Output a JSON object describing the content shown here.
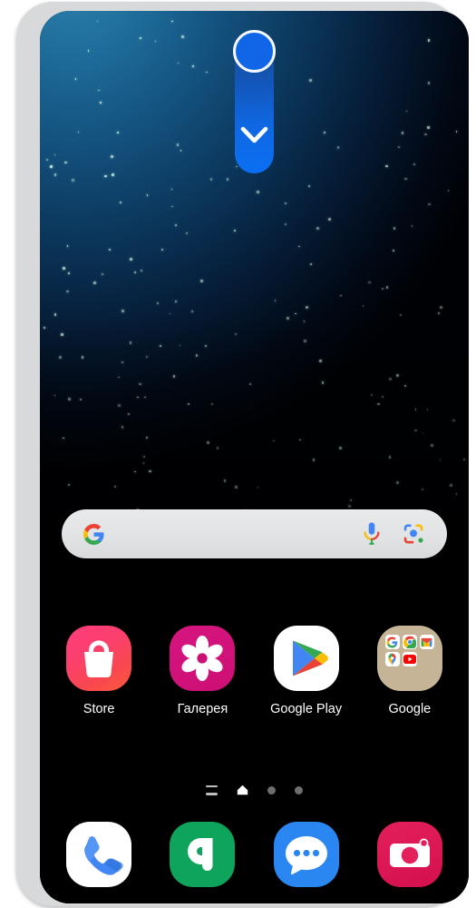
{
  "device": {
    "frame_color": "#d8d9da",
    "screen_background": "#000000"
  },
  "wallpaper": {
    "name": "starry-night-sky",
    "top_glow_color": "#2e82ad",
    "mid_color": "#0c3a60",
    "bottom_color": "#000000",
    "star_color": "#cfeede"
  },
  "widget": {
    "name": "edge-pull-handle",
    "circle_color": "#1066e6",
    "ring_color": "#f5f8ff",
    "pill_top_color": "#1b4e96",
    "pill_bottom_color": "#0b6ff2",
    "chevron_icon": "chevron-down-icon",
    "chevron_color": "#ffffff"
  },
  "search": {
    "placeholder": "",
    "value": "",
    "background": "#e4e5e6",
    "google_logo": "google-g-icon",
    "mic_icon": "microphone-icon",
    "lens_icon": "google-lens-icon"
  },
  "apps": [
    {
      "label": "Store",
      "icon": "galaxy-store-icon",
      "glyph": "shopping-bag",
      "bg_start": "#ff3d7c",
      "bg_end": "#fb5a3c",
      "fg": "#ffffff"
    },
    {
      "label": "Галерея",
      "icon": "gallery-icon",
      "glyph": "flower",
      "bg_start": "#d6157f",
      "bg_end": "#cd0f75",
      "fg": "#ffffff"
    },
    {
      "label": "Google Play",
      "icon": "google-play-icon",
      "glyph": "play-triangle",
      "bg_start": "#ffffff",
      "bg_end": "#ffffff",
      "fg": "#34a853"
    },
    {
      "label": "Google",
      "icon": "google-folder-icon",
      "glyph": "folder",
      "bg_start": "#c5b496",
      "bg_end": "#c5b496",
      "fg": "#ffffff",
      "contents": [
        {
          "label": "Google",
          "icon": "google-g-icon"
        },
        {
          "label": "Chrome",
          "icon": "chrome-icon"
        },
        {
          "label": "Gmail",
          "icon": "gmail-icon"
        },
        {
          "label": "Maps",
          "icon": "google-maps-icon"
        },
        {
          "label": "YouTube",
          "icon": "youtube-icon"
        }
      ]
    }
  ],
  "page_indicator": {
    "apps_list_icon": "app-list-icon",
    "home_icon": "home-page-icon",
    "pages": 4,
    "active_page": 2,
    "active_color": "#ffffff",
    "inactive_color": "#6e6e6e"
  },
  "dock": [
    {
      "label": "Phone",
      "icon": "phone-icon",
      "bg": "#ffffff",
      "fg": "#4285f4"
    },
    {
      "label": "Contacts",
      "icon": "contacts-icon",
      "bg": "#0fa45c",
      "fg": "#ffffff"
    },
    {
      "label": "Messages",
      "icon": "messages-icon",
      "bg": "#2a86f0",
      "fg": "#ffffff"
    },
    {
      "label": "Camera",
      "icon": "camera-icon",
      "bg": "#e3205b",
      "fg": "#ffffff"
    }
  ]
}
